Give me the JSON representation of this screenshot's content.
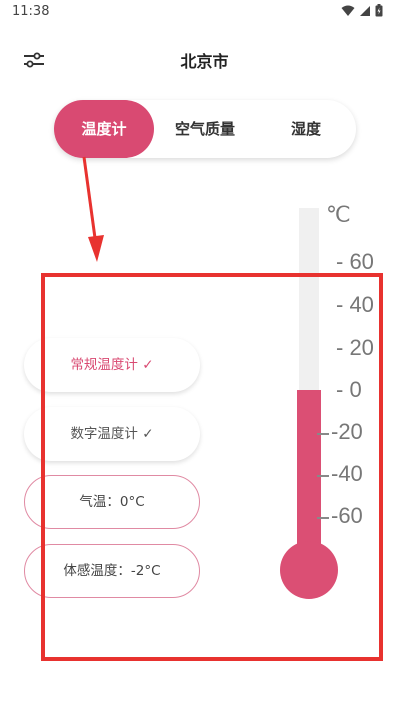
{
  "status_bar": {
    "time": "11:38"
  },
  "header": {
    "title": "北京市"
  },
  "tabs": [
    {
      "label": "温度计",
      "active": true
    },
    {
      "label": "空气质量",
      "active": false
    },
    {
      "label": "湿度",
      "active": false
    }
  ],
  "pills": {
    "regular_thermometer": "常规温度计 ✓",
    "digital_thermometer": "数字温度计 ✓",
    "temperature": "气温：0°C",
    "feels_like": "体感温度：-2°C"
  },
  "thermometer": {
    "unit": "℃",
    "scale_labels": [
      "- 60",
      "- 40",
      "- 20",
      "- 0",
      "-20",
      "-40",
      "-60"
    ],
    "fill_color": "#db4f74",
    "track_color": "#f0f0f0"
  },
  "colors": {
    "accent": "#d94a72",
    "annotation": "#e8322f"
  }
}
